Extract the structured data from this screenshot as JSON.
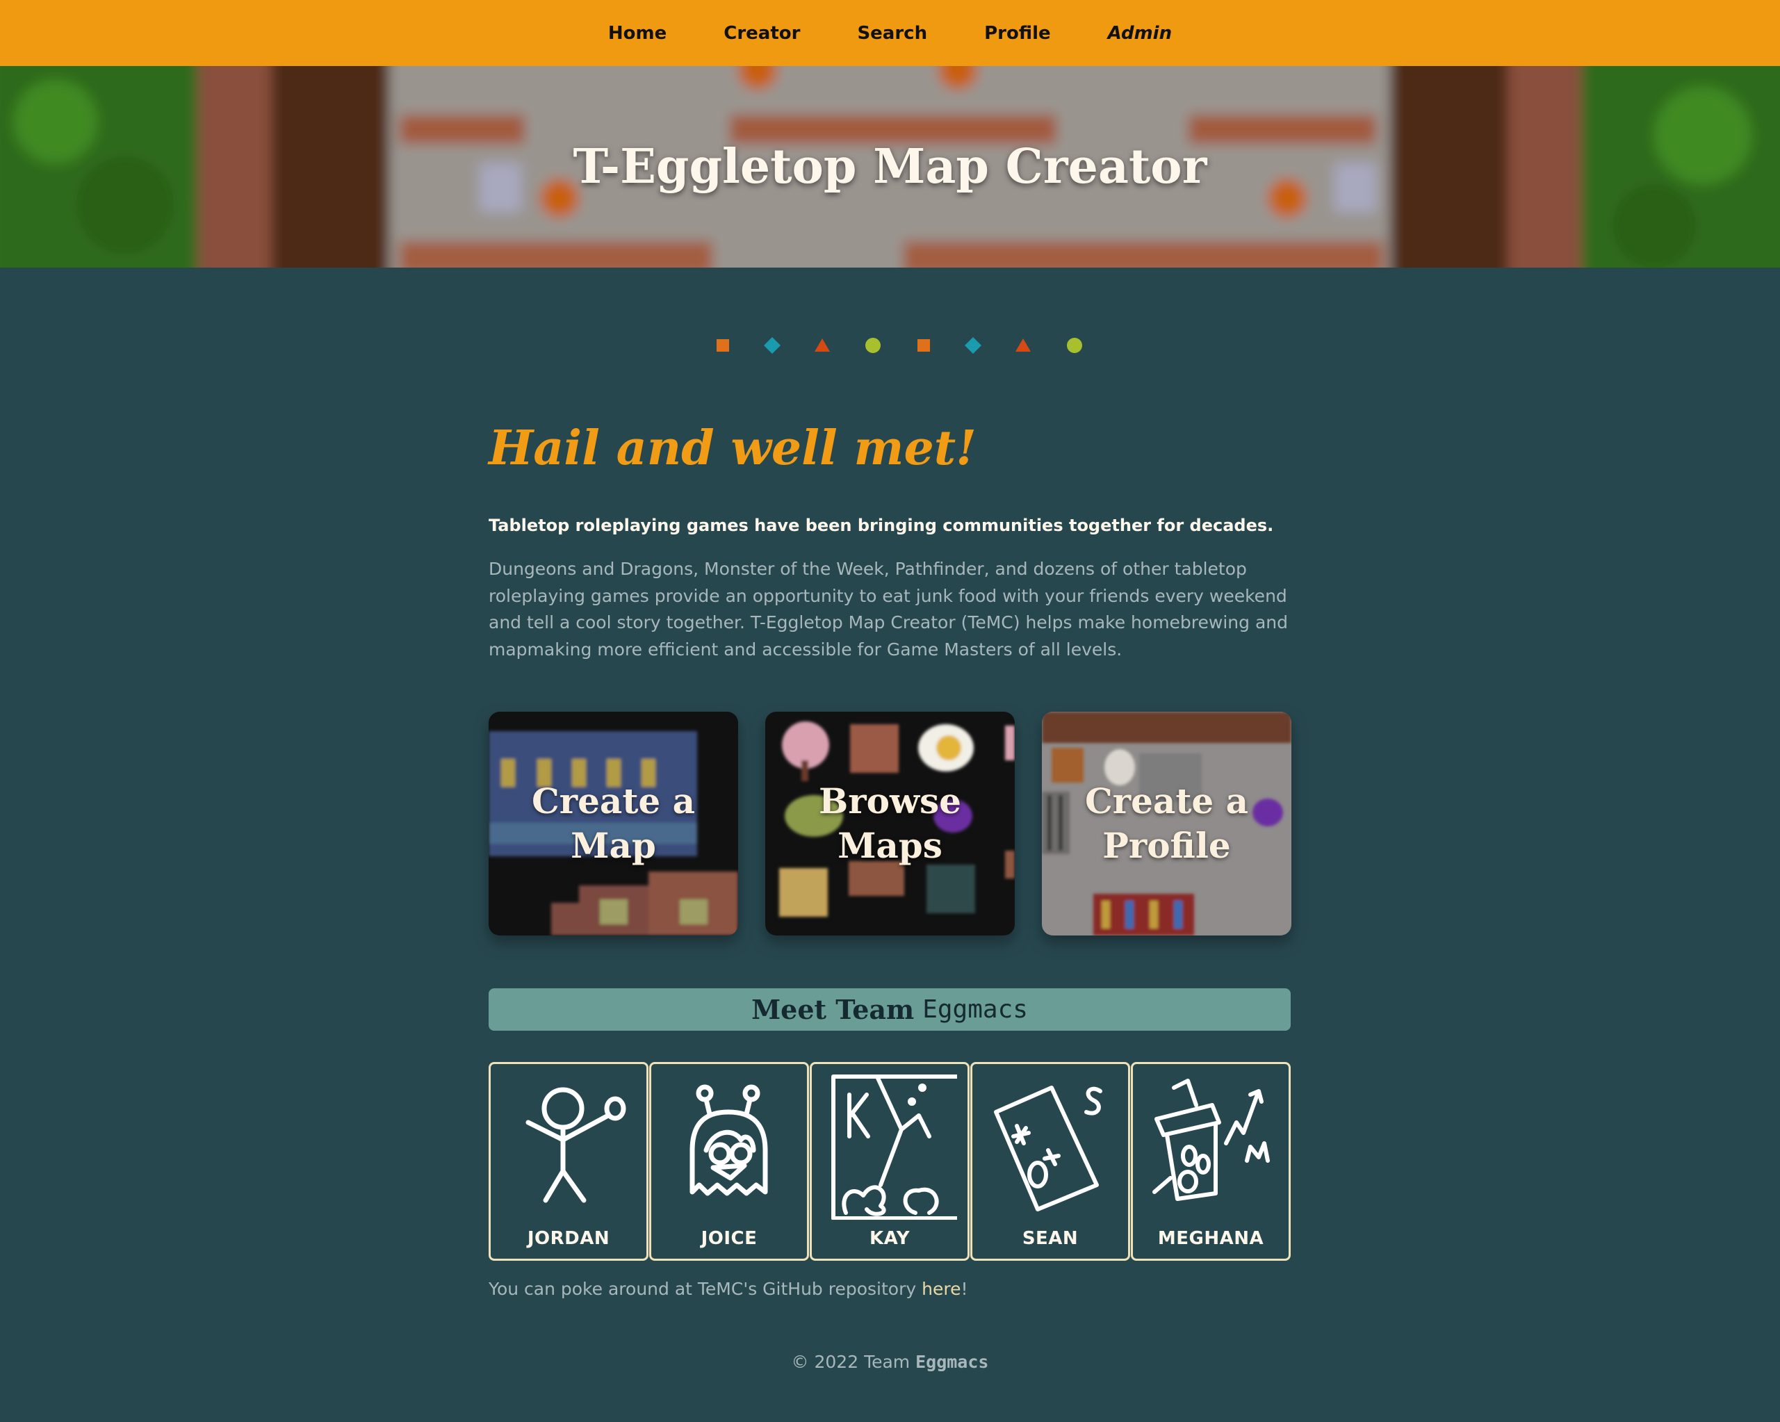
{
  "nav": {
    "items": [
      "Home",
      "Creator",
      "Search",
      "Profile"
    ],
    "admin_label": "Admin"
  },
  "hero": {
    "title": "T-Eggletop Map Creator"
  },
  "decor": {
    "shapes": [
      "square",
      "diamond",
      "triangle",
      "circle",
      "square",
      "diamond",
      "triangle",
      "circle"
    ],
    "colors": {
      "square": "#e0701a",
      "diamond": "#1b9bb0",
      "triangle": "#d44a12",
      "circle": "#a9c02e"
    }
  },
  "intro": {
    "greeting": "Hail and well met!",
    "lead": "Tabletop roleplaying games have been bringing communities together for decades.",
    "body": "Dungeons and Dragons, Monster of the Week, Pathfinder, and dozens of other tabletop roleplaying games provide an opportunity to eat junk food with your friends every weekend and tell a cool story together. T-Eggletop Map Creator (TeMC) helps make homebrewing and mapmaking more efficient and accessible for Game Masters of all levels."
  },
  "cards": [
    {
      "label": "Create a Map"
    },
    {
      "label": "Browse Maps"
    },
    {
      "label": "Create a Profile"
    }
  ],
  "team": {
    "heading_prefix": "Meet Team",
    "heading_brand": "Eggmacs",
    "members": [
      "JORDAN",
      "JOICE",
      "KAY",
      "SEAN",
      "MEGHANA"
    ]
  },
  "repo": {
    "text": "You can poke around at TeMC's GitHub repository ",
    "link": "here",
    "suffix": "!"
  },
  "footer": {
    "text": "© 2022 Team",
    "brand": "Eggmacs"
  },
  "colors": {
    "nav_bg": "#f09a12",
    "page_bg": "#27474f",
    "accent_orange": "#f19c14",
    "team_header_bg": "#6a9d96",
    "member_border": "#efe1b8"
  }
}
